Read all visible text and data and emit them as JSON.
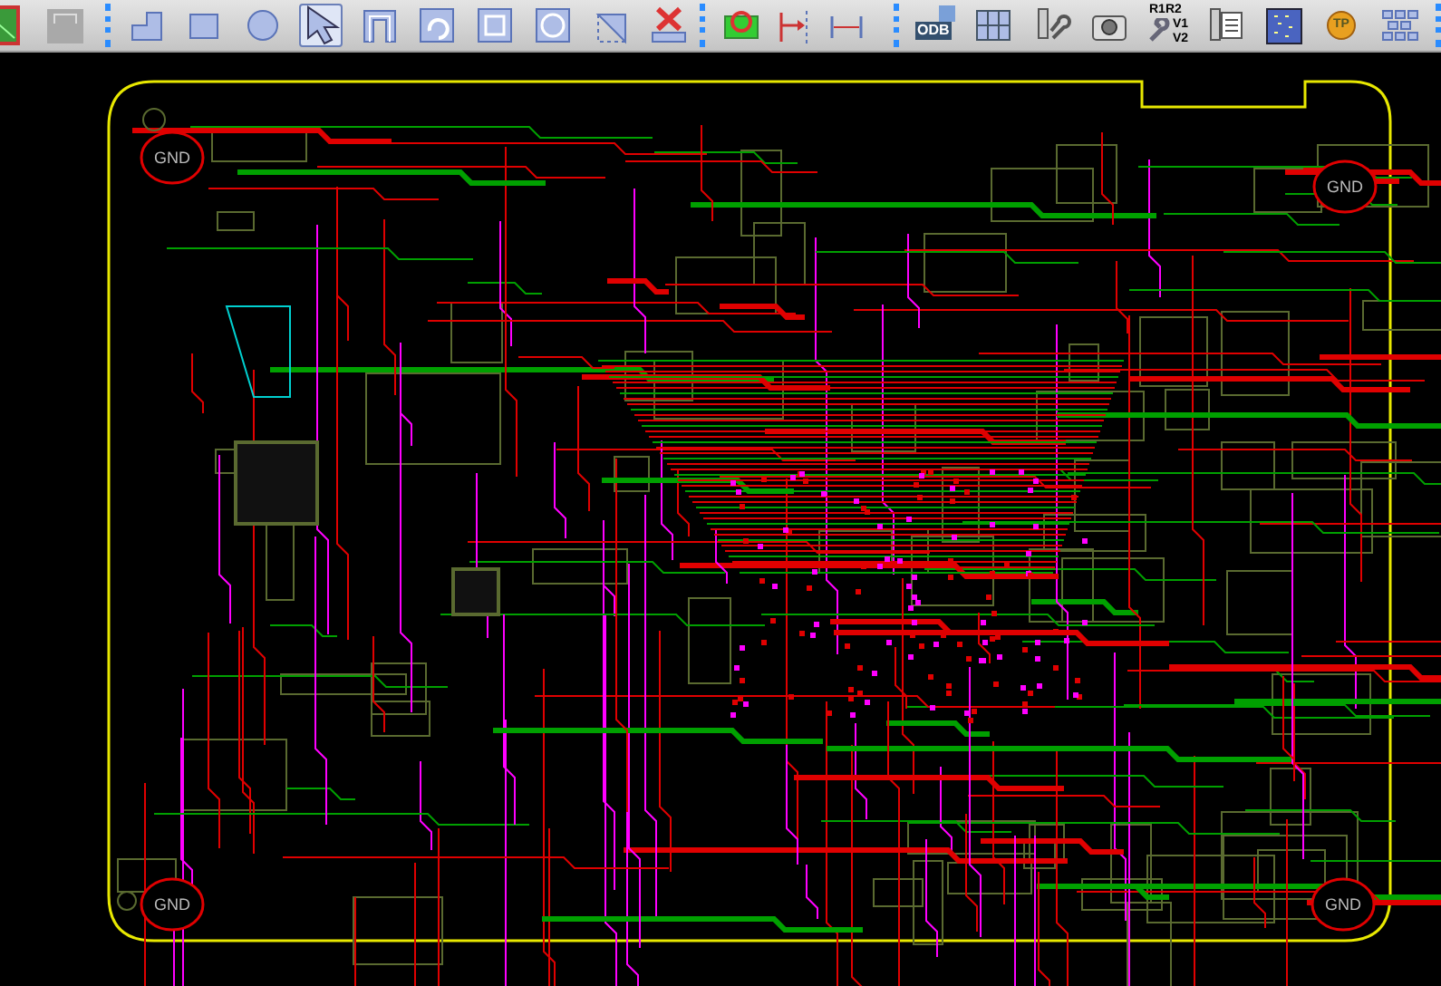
{
  "toolbar": {
    "groups": [
      [
        {
          "kind": "board",
          "selected": false
        },
        {
          "kind": "blank",
          "selected": false
        }
      ],
      [
        {
          "kind": "corner",
          "selected": false
        },
        {
          "kind": "rect",
          "selected": false
        },
        {
          "kind": "circle",
          "selected": false
        },
        {
          "kind": "pointer",
          "selected": true
        },
        {
          "kind": "nested",
          "selected": false
        },
        {
          "kind": "arc",
          "selected": false
        },
        {
          "kind": "square",
          "selected": false
        },
        {
          "kind": "ring",
          "selected": false
        },
        {
          "kind": "triangle",
          "selected": false
        },
        {
          "kind": "delete",
          "selected": false
        }
      ],
      [
        {
          "kind": "drc",
          "selected": false
        },
        {
          "kind": "measure",
          "selected": false
        },
        {
          "kind": "dimension",
          "selected": false
        }
      ],
      [
        {
          "kind": "odb",
          "selected": false,
          "label": "ODB"
        },
        {
          "kind": "columns",
          "selected": false
        },
        {
          "kind": "wrench",
          "selected": false
        },
        {
          "kind": "camera",
          "selected": false
        },
        {
          "kind": "renumber",
          "selected": false,
          "label": "R1R2",
          "sub": [
            "V1",
            "V2"
          ]
        },
        {
          "kind": "list",
          "selected": false
        },
        {
          "kind": "grid",
          "selected": false
        },
        {
          "kind": "testpoint",
          "selected": false,
          "label": "TP"
        },
        {
          "kind": "matrix",
          "selected": false
        }
      ]
    ]
  },
  "board": {
    "labels": [
      {
        "text": "GND"
      },
      {
        "text": "GND"
      },
      {
        "text": "GND"
      },
      {
        "text": "GND"
      }
    ]
  }
}
